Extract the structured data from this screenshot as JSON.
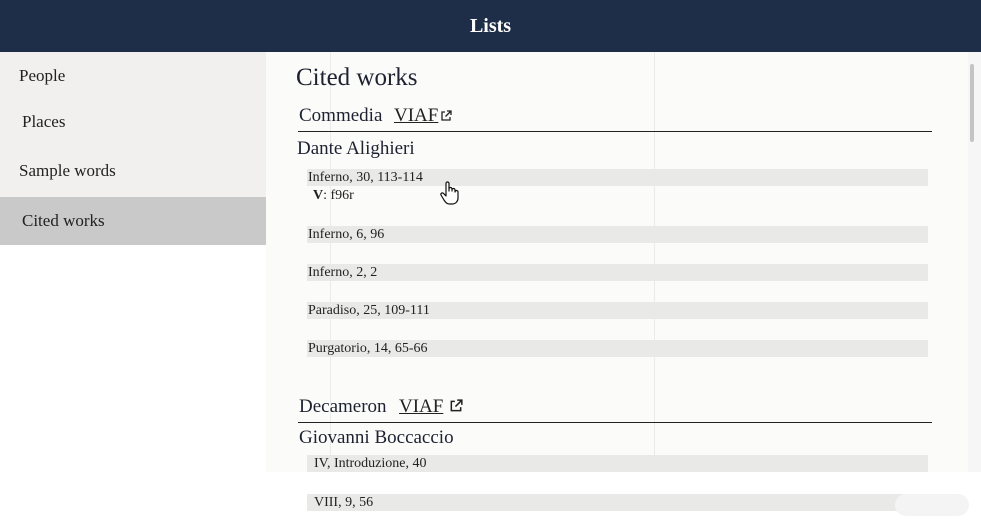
{
  "topbar": {
    "title": "Lists"
  },
  "sidebar": {
    "items": [
      {
        "label": "People"
      },
      {
        "label": "Places"
      },
      {
        "label": "Sample words"
      },
      {
        "label": "Cited works"
      }
    ]
  },
  "main": {
    "heading": "Cited works",
    "works": [
      {
        "title": "Commedia",
        "viaf_label": "VIAF",
        "author": "Dante Alighieri",
        "refs": [
          {
            "text": "Inferno, 30, 113-114",
            "witness_siglum": "V",
            "witness_text": ": f96r"
          },
          {
            "text": "Inferno, 6, 96"
          },
          {
            "text": "Inferno, 2, 2"
          },
          {
            "text": "Paradiso, 25, 109-111"
          },
          {
            "text": "Purgatorio, 14, 65-66"
          }
        ]
      },
      {
        "title": "Decameron",
        "viaf_label": "VIAF",
        "author": "Giovanni Boccaccio",
        "refs": [
          {
            "text": "IV, Introduzione, 40"
          },
          {
            "text": "VIII, 9, 56"
          }
        ]
      }
    ]
  },
  "colors": {
    "topbar": "#1f2e48",
    "sidebar_bg": "#f1f0ef",
    "sidebar_active": "#c9c9c9",
    "ref_bg": "#e9eae8"
  }
}
